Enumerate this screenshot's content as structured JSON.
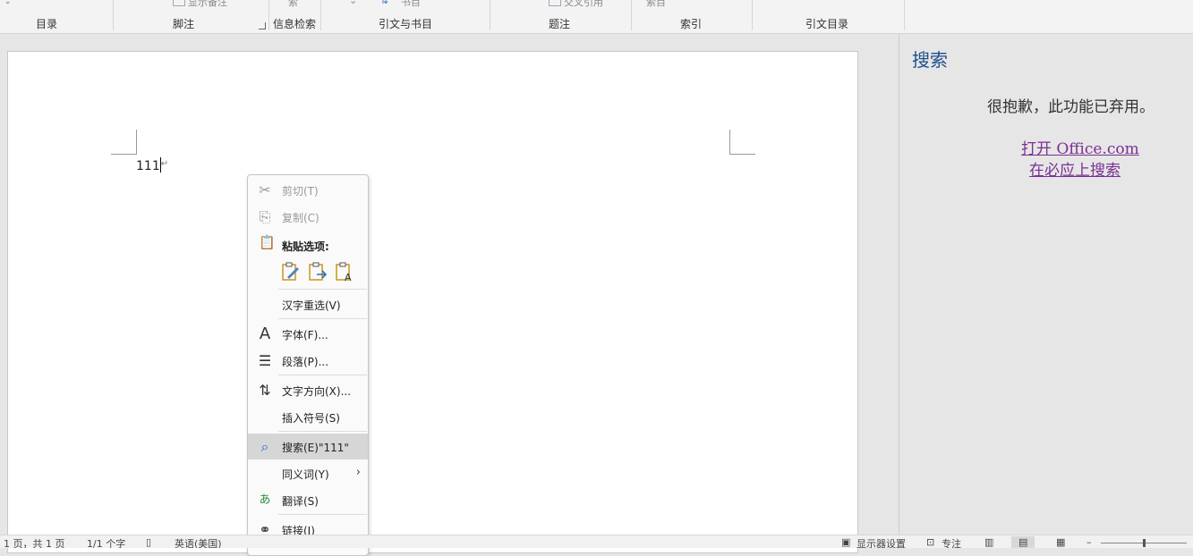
{
  "ribbon": {
    "frag_footnote": "显示备注",
    "frag_search": "索",
    "frag_style": "书目",
    "frag_cross": "交叉引用",
    "frag_index": "索目",
    "groups": {
      "toc": "目录",
      "footnote": "脚注",
      "research": "信息检索",
      "citations": "引文与书目",
      "captions": "题注",
      "index": "索引",
      "toa": "引文目录"
    }
  },
  "document": {
    "text": "111"
  },
  "pane": {
    "title": "搜索",
    "message": "很抱歉，此功能已弃用。",
    "link1": "打开 Office.com",
    "link2": "在必应上搜索"
  },
  "context_menu": {
    "cut": "剪切(T)",
    "copy": "复制(C)",
    "paste_options": "粘贴选项:",
    "reconvert": "汉字重选(V)",
    "font": "字体(F)...",
    "paragraph": "段落(P)...",
    "text_direction": "文字方向(X)...",
    "insert_symbol": "插入符号(S)",
    "search": "搜索(E)\"111\"",
    "synonyms": "同义词(Y)",
    "translate": "翻译(S)",
    "link": "链接(I)"
  },
  "status": {
    "page": "1 页，共 1 页",
    "words": "1/1 个字",
    "language": "英语(美国)",
    "display": "显示器设置",
    "focus": "专注"
  }
}
